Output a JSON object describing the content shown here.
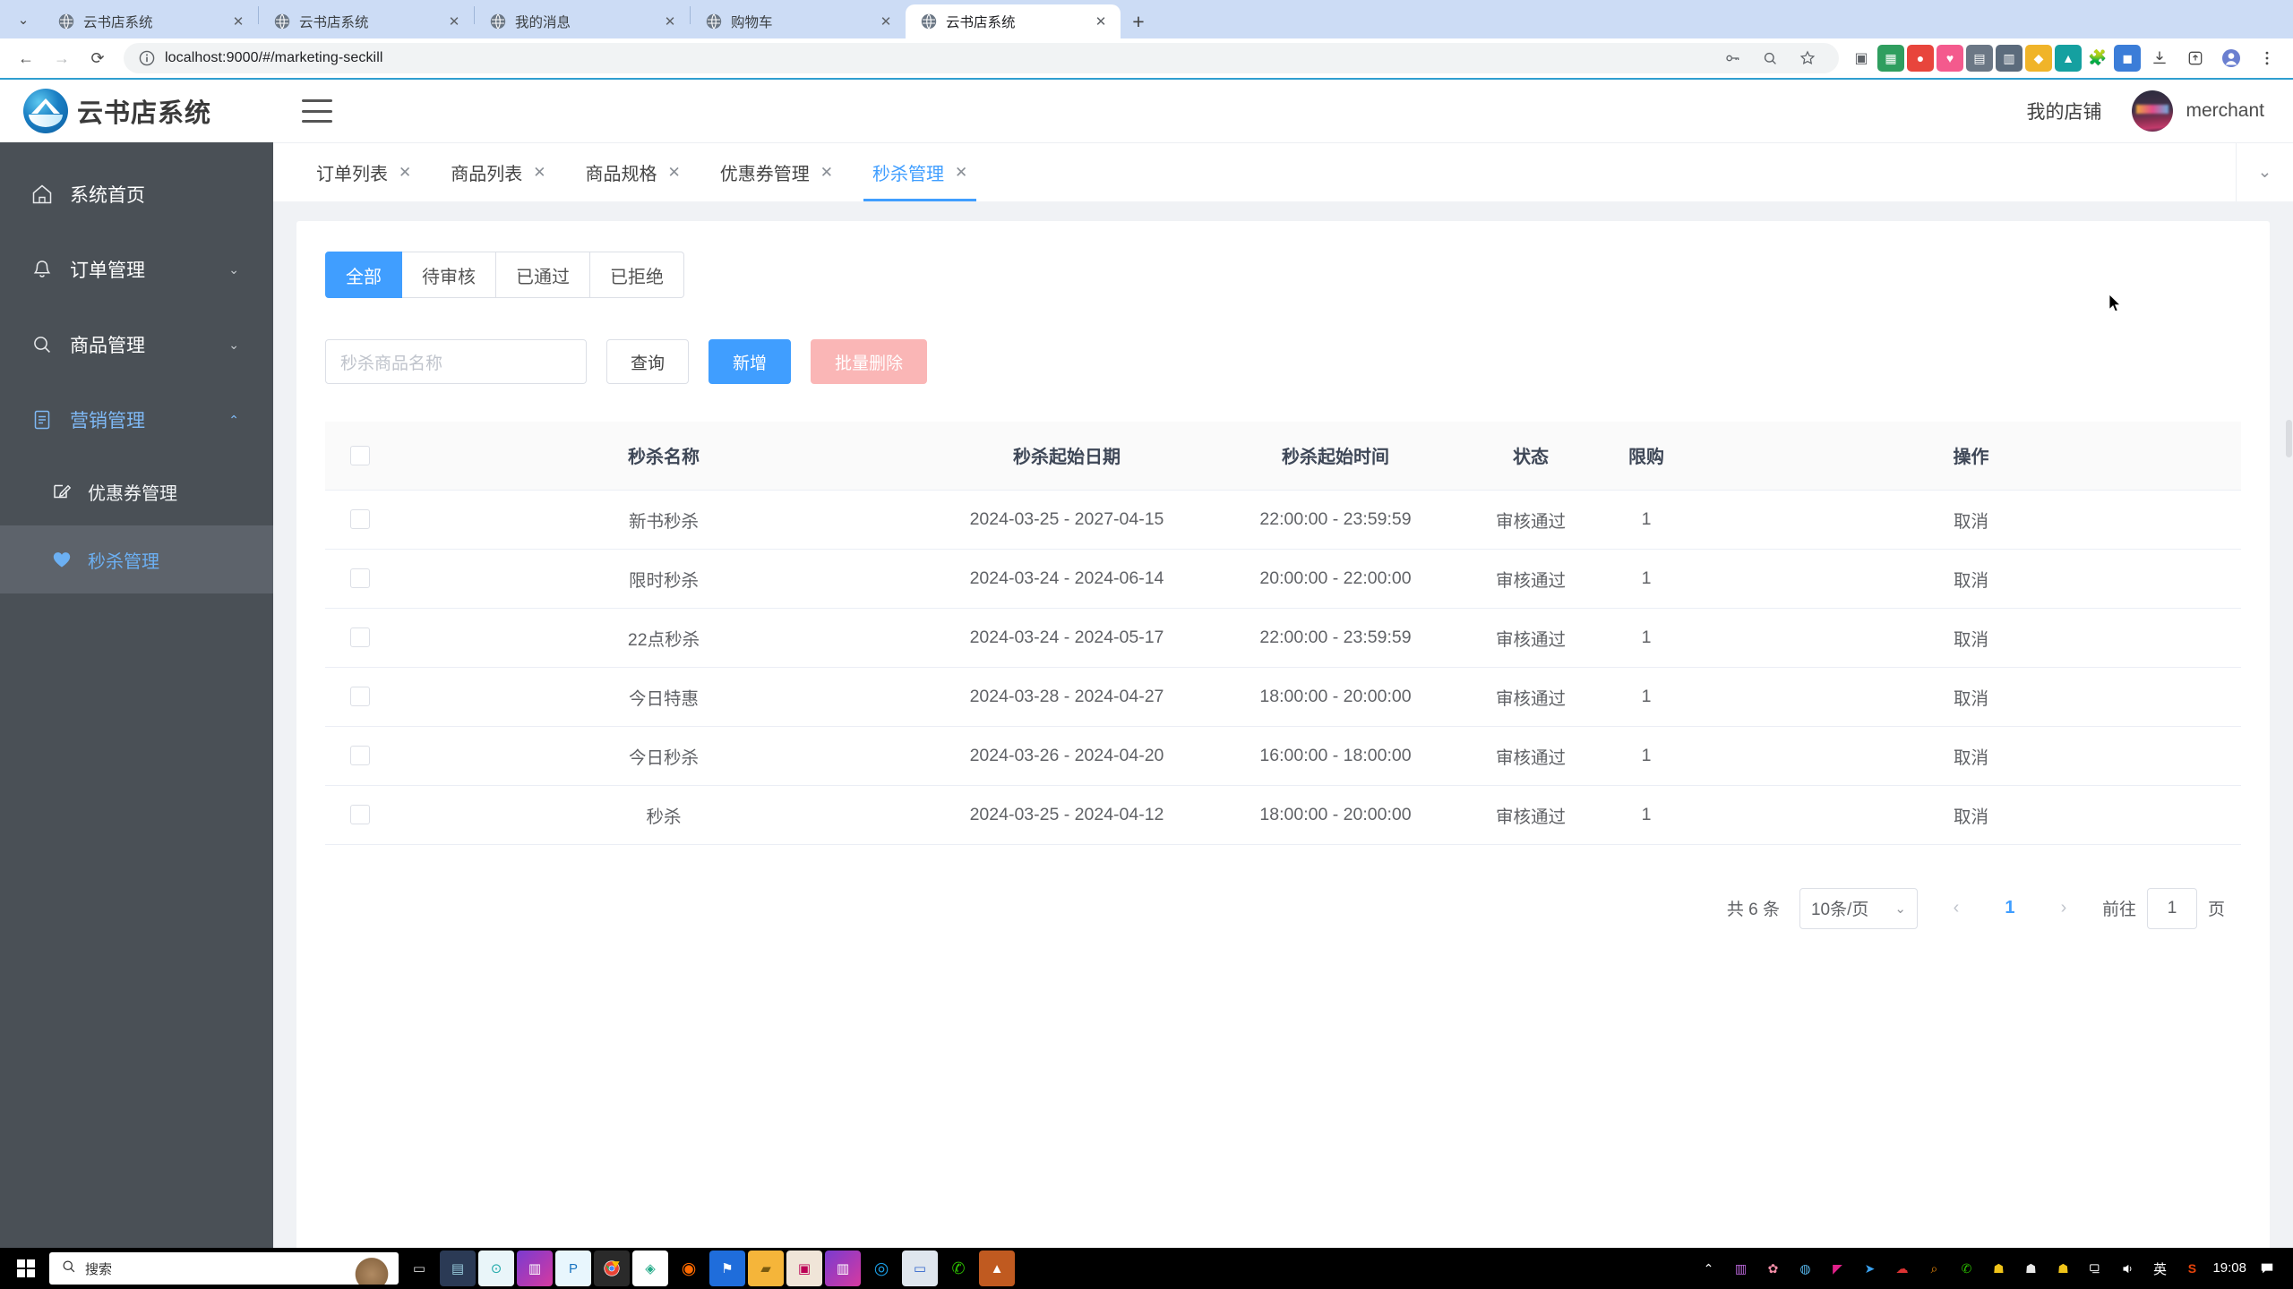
{
  "browser": {
    "tabs": [
      {
        "title": "云书店系统",
        "active": false
      },
      {
        "title": "云书店系统",
        "active": false
      },
      {
        "title": "我的消息",
        "active": false
      },
      {
        "title": "购物车",
        "active": false
      },
      {
        "title": "云书店系统",
        "active": true
      }
    ],
    "new_tab_label": "+",
    "close_label": "✕",
    "nav": {
      "back": "←",
      "forward": "→",
      "reload": "⟳"
    },
    "url": "localhost:9000/#/marketing-seckill",
    "site_info_icon": "info-icon"
  },
  "app": {
    "logo_text": "云书店系统",
    "topbar": {
      "menu_icon": "hamburger-icon",
      "shop_link": "我的店铺",
      "user_name": "merchant"
    },
    "sidebar": [
      {
        "label": "系统首页",
        "icon": "home-icon",
        "expandable": false,
        "arrow": ""
      },
      {
        "label": "订单管理",
        "icon": "bell-icon",
        "expandable": true,
        "arrow": "⌄"
      },
      {
        "label": "商品管理",
        "icon": "search-icon",
        "expandable": true,
        "arrow": "⌄"
      },
      {
        "label": "营销管理",
        "icon": "document-icon",
        "expandable": true,
        "arrow": "⌃"
      }
    ],
    "sidebar_sub": [
      {
        "label": "优惠券管理",
        "icon": "edit-icon",
        "active": false
      },
      {
        "label": "秒杀管理",
        "icon": "heart-icon",
        "active": true
      }
    ],
    "page_tabs": [
      {
        "label": "订单列表",
        "close": "✕",
        "active": false
      },
      {
        "label": "商品列表",
        "close": "✕",
        "active": false
      },
      {
        "label": "商品规格",
        "close": "✕",
        "active": false
      },
      {
        "label": "优惠券管理",
        "close": "✕",
        "active": false
      },
      {
        "label": "秒杀管理",
        "close": "✕",
        "active": true
      }
    ],
    "page_tabs_caret": "⌄"
  },
  "filters": {
    "segments": [
      {
        "label": "全部",
        "active": true
      },
      {
        "label": "待审核",
        "active": false
      },
      {
        "label": "已通过",
        "active": false
      },
      {
        "label": "已拒绝",
        "active": false
      }
    ],
    "search_placeholder": "秒杀商品名称",
    "search_value": "",
    "query_button": "查询",
    "add_button": "新增",
    "batch_delete_button": "批量删除"
  },
  "table": {
    "columns": [
      "",
      "秒杀名称",
      "秒杀起始日期",
      "秒杀起始时间",
      "状态",
      "限购",
      "操作"
    ],
    "rows": [
      {
        "name": "新书秒杀",
        "date": "2024-03-25 - 2027-04-15",
        "time": "22:00:00 - 23:59:59",
        "status": "审核通过",
        "limit": "1",
        "action": "取消"
      },
      {
        "name": "限时秒杀",
        "date": "2024-03-24 - 2024-06-14",
        "time": "20:00:00 - 22:00:00",
        "status": "审核通过",
        "limit": "1",
        "action": "取消"
      },
      {
        "name": "22点秒杀",
        "date": "2024-03-24 - 2024-05-17",
        "time": "22:00:00 - 23:59:59",
        "status": "审核通过",
        "limit": "1",
        "action": "取消"
      },
      {
        "name": "今日特惠",
        "date": "2024-03-28 - 2024-04-27",
        "time": "18:00:00 - 20:00:00",
        "status": "审核通过",
        "limit": "1",
        "action": "取消"
      },
      {
        "name": "今日秒杀",
        "date": "2024-03-26 - 2024-04-20",
        "time": "16:00:00 - 18:00:00",
        "status": "审核通过",
        "limit": "1",
        "action": "取消"
      },
      {
        "name": "秒杀",
        "date": "2024-03-25 - 2024-04-12",
        "time": "18:00:00 - 20:00:00",
        "status": "审核通过",
        "limit": "1",
        "action": "取消"
      }
    ]
  },
  "pagination": {
    "total_text": "共 6 条",
    "page_size": "10条/页",
    "prev": "‹",
    "next": "›",
    "current_page": "1",
    "jump_prefix": "前往",
    "jump_value": "1",
    "jump_suffix": "页"
  },
  "taskbar": {
    "search_placeholder": "搜索",
    "clock_time": "19:08",
    "ime_label": "英",
    "overflow_caret": "⌃"
  },
  "colors": {
    "accent": "#409eff",
    "sidebar_bg": "#4a5056",
    "danger_disabled": "#fab6b6",
    "link": "#409eff"
  }
}
